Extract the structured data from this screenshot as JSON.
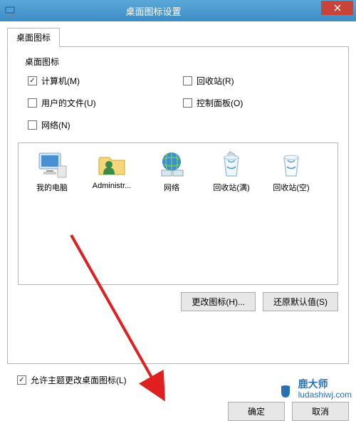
{
  "window": {
    "title": "桌面图标设置"
  },
  "tab": {
    "label": "桌面图标"
  },
  "group": {
    "heading": "桌面图标",
    "checkboxes": {
      "computer": {
        "label": "计算机(M)",
        "checked": true
      },
      "recycle": {
        "label": "回收站(R)",
        "checked": false
      },
      "userfiles": {
        "label": "用户的文件(U)",
        "checked": false
      },
      "control": {
        "label": "控制面板(O)",
        "checked": false
      },
      "network": {
        "label": "网络(N)",
        "checked": false
      }
    }
  },
  "preview": {
    "items": [
      {
        "name": "computer-icon",
        "label": "我的电脑"
      },
      {
        "name": "user-folder-icon",
        "label": "Administr..."
      },
      {
        "name": "network-icon",
        "label": "网络"
      },
      {
        "name": "recycle-full-icon",
        "label": "回收站(满)"
      },
      {
        "name": "recycle-empty-icon",
        "label": "回收站(空)"
      }
    ]
  },
  "buttons": {
    "change_icon": "更改图标(H)...",
    "restore_default": "还原默认值(S)",
    "ok": "确定",
    "cancel": "取消"
  },
  "allow_themes": {
    "label": "允许主题更改桌面图标(L)",
    "checked": true
  },
  "watermark": {
    "brand": "鹿大师",
    "url": "ludashiwj.com"
  }
}
